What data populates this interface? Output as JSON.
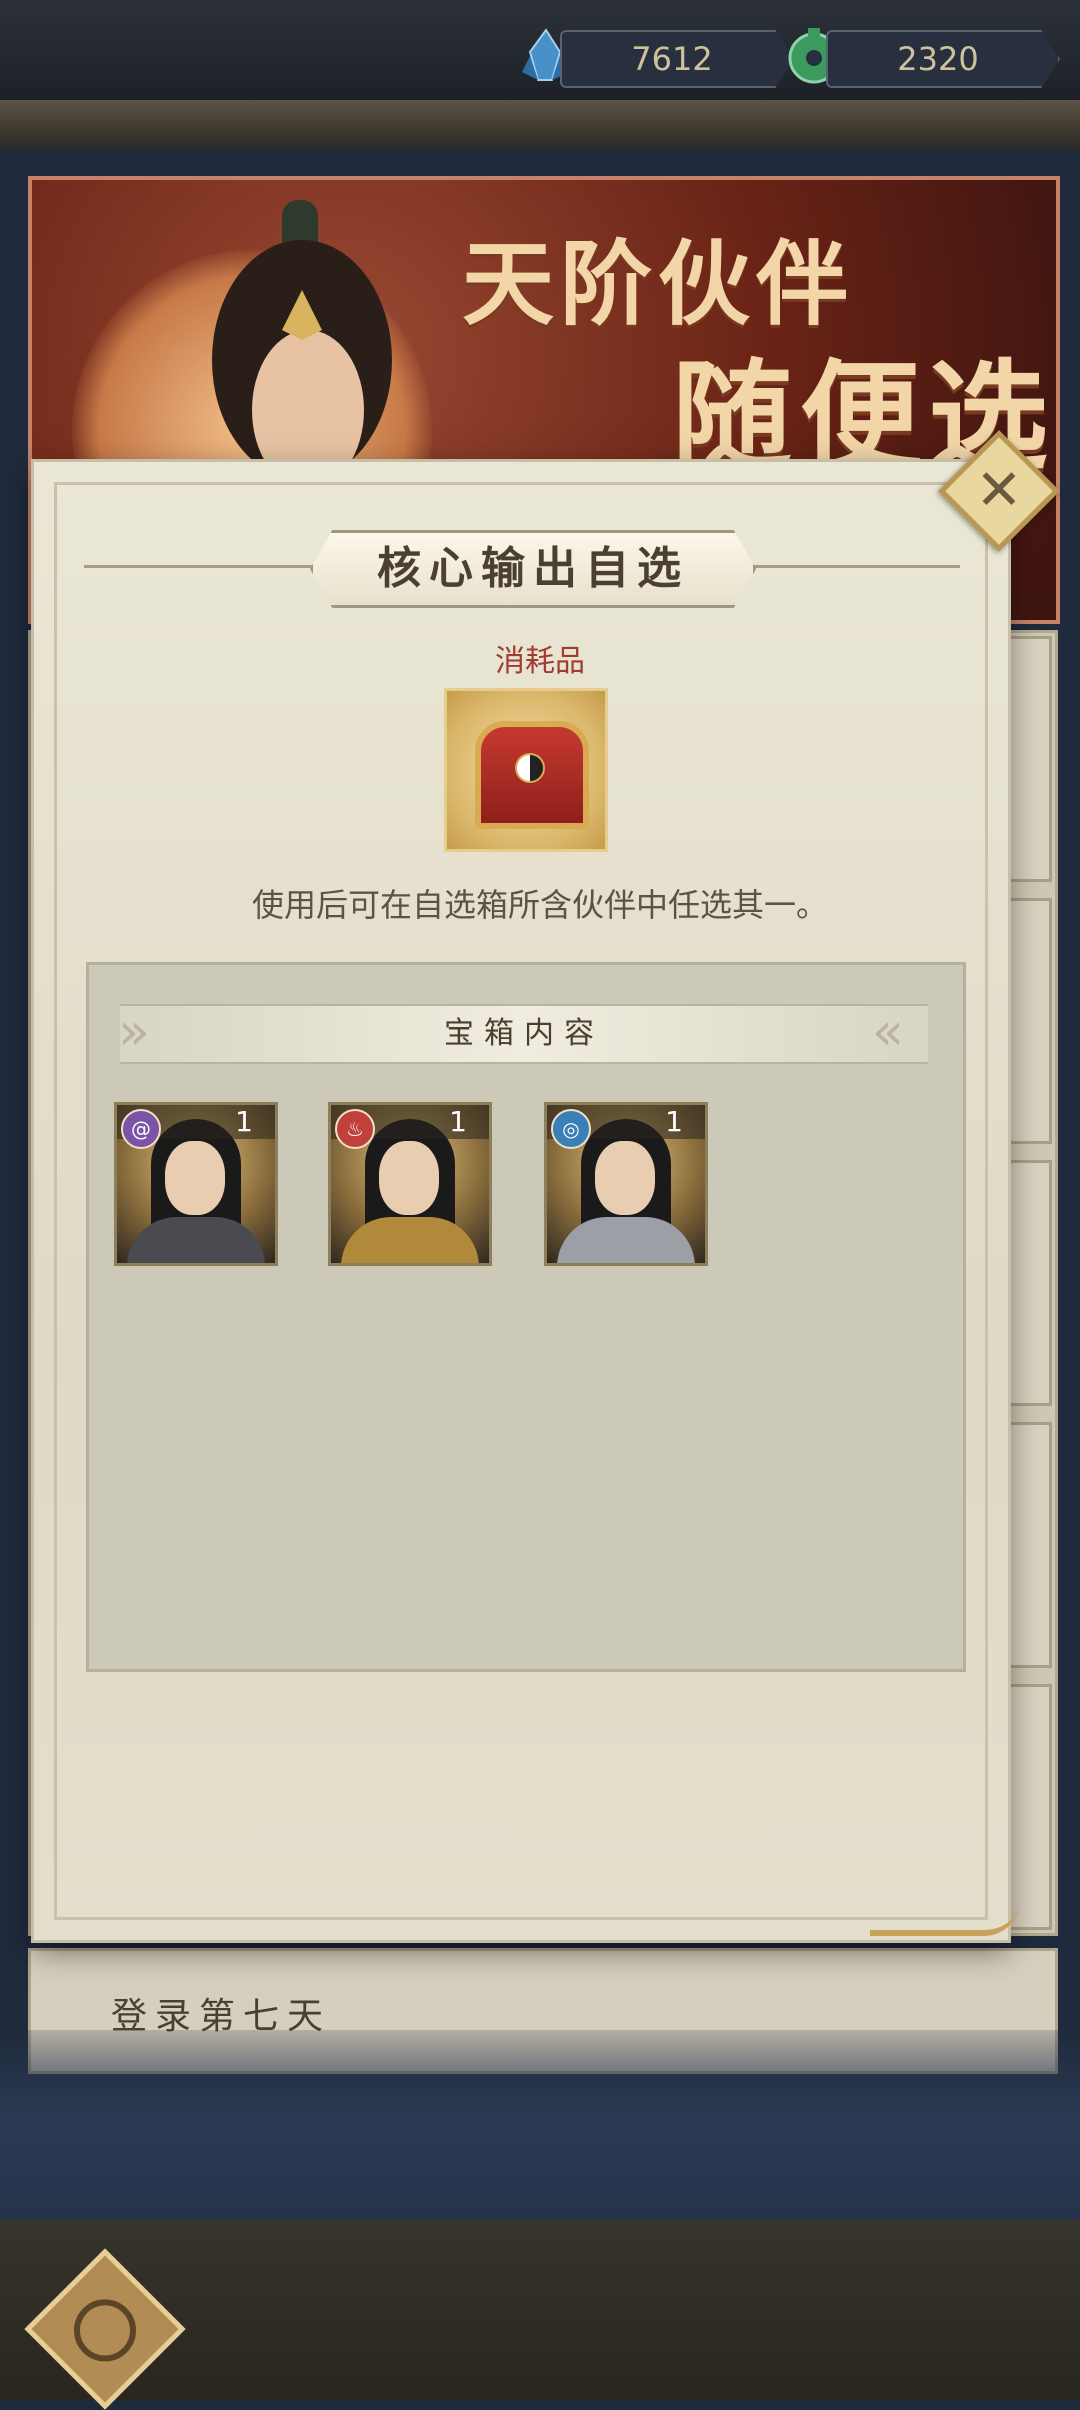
{
  "currencies": [
    {
      "name": "crystal",
      "value": "7612",
      "icon": "blue-crystal-icon",
      "color": "#4a90c8"
    },
    {
      "name": "jade",
      "value": "2320",
      "icon": "jade-coin-icon",
      "color": "#3b9a5e"
    }
  ],
  "banner": {
    "title_line1": "天阶伙伴",
    "title_line2": "随便选"
  },
  "modal": {
    "title": "核心输出自选",
    "item_type": "消耗品",
    "item_icon": "treasure-chest-icon",
    "description": "使用后可在自选箱所含伙伴中任选其一。",
    "contents_header": "宝箱内容",
    "heroes": [
      {
        "element": "wind",
        "element_icon": "swirl-element-icon",
        "element_color": "#7b54a8",
        "count": "1"
      },
      {
        "element": "fire",
        "element_icon": "flame-element-icon",
        "element_color": "#c0413a",
        "count": "1"
      },
      {
        "element": "water",
        "element_icon": "wave-element-icon",
        "element_color": "#3b7fb8",
        "count": "1"
      }
    ]
  },
  "background": {
    "login_day_label": "登录第七天"
  }
}
